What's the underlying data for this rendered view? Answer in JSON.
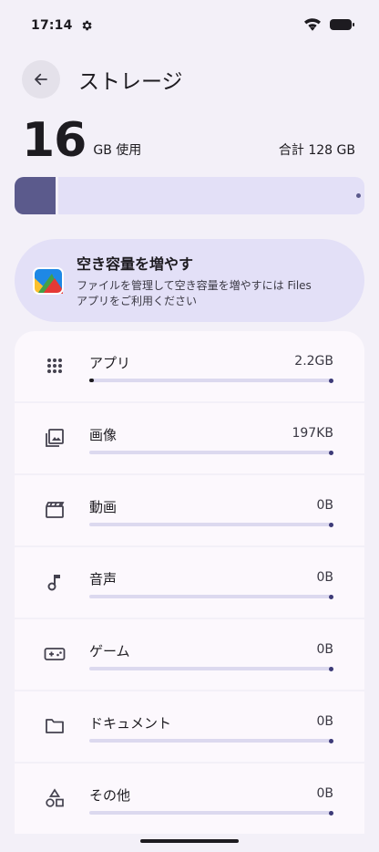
{
  "status_bar": {
    "time": "17:14"
  },
  "header": {
    "title": "ストレージ"
  },
  "usage": {
    "used_number": "16",
    "used_unit": "GB 使用",
    "total": "合計 128 GB",
    "used_fraction": 0.125
  },
  "free_up": {
    "title": "空き容量を増やす",
    "description_line1": "ファイルを管理して空き容量を増やすには Files",
    "description_line2": "アプリをご利用ください",
    "icon": "files-app-icon"
  },
  "categories": [
    {
      "label": "アプリ",
      "value": "2.2GB",
      "icon": "apps-grid-icon",
      "fraction": 0.017
    },
    {
      "label": "画像",
      "value": "197KB",
      "icon": "image-icon",
      "fraction": 0
    },
    {
      "label": "動画",
      "value": "0B",
      "icon": "video-clapper-icon",
      "fraction": 0
    },
    {
      "label": "音声",
      "value": "0B",
      "icon": "music-note-icon",
      "fraction": 0
    },
    {
      "label": "ゲーム",
      "value": "0B",
      "icon": "gamepad-icon",
      "fraction": 0
    },
    {
      "label": "ドキュメント",
      "value": "0B",
      "icon": "folder-icon",
      "fraction": 0
    },
    {
      "label": "その他",
      "value": "0B",
      "icon": "shapes-icon",
      "fraction": 0
    }
  ],
  "colors": {
    "background": "#f3f0f8",
    "accent": "#5b5a8c",
    "card": "#fcf8fd",
    "tint": "#e3e0f7"
  }
}
